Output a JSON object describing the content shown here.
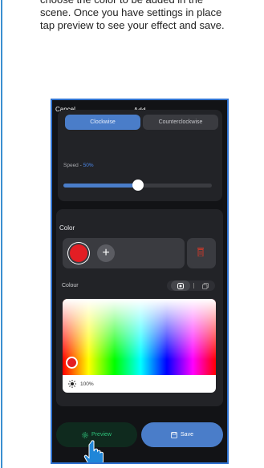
{
  "caption": {
    "line1": "choose the color to be added in the",
    "line2": "scene. Once you have settings in place",
    "line3": "tap preview to see your effect and save."
  },
  "topbar": {
    "cancel": "Cancel",
    "title": "Add"
  },
  "direction": {
    "clockwise": "Clockwise",
    "counterclockwise": "Counterclockwise",
    "selected": "Clockwise"
  },
  "speed": {
    "label": "Speed - ",
    "value": "50%",
    "level_percent": 50
  },
  "color_section": {
    "title": "Color",
    "selected_color": "#e31e24",
    "colour_label": "Colour",
    "brightness": "100%"
  },
  "buttons": {
    "preview": "Preview",
    "save": "Save"
  },
  "colors": {
    "accent": "#4a7dc9",
    "preview_text": "#2ec27a",
    "frame": "#2f72d0",
    "background": "#121316"
  }
}
